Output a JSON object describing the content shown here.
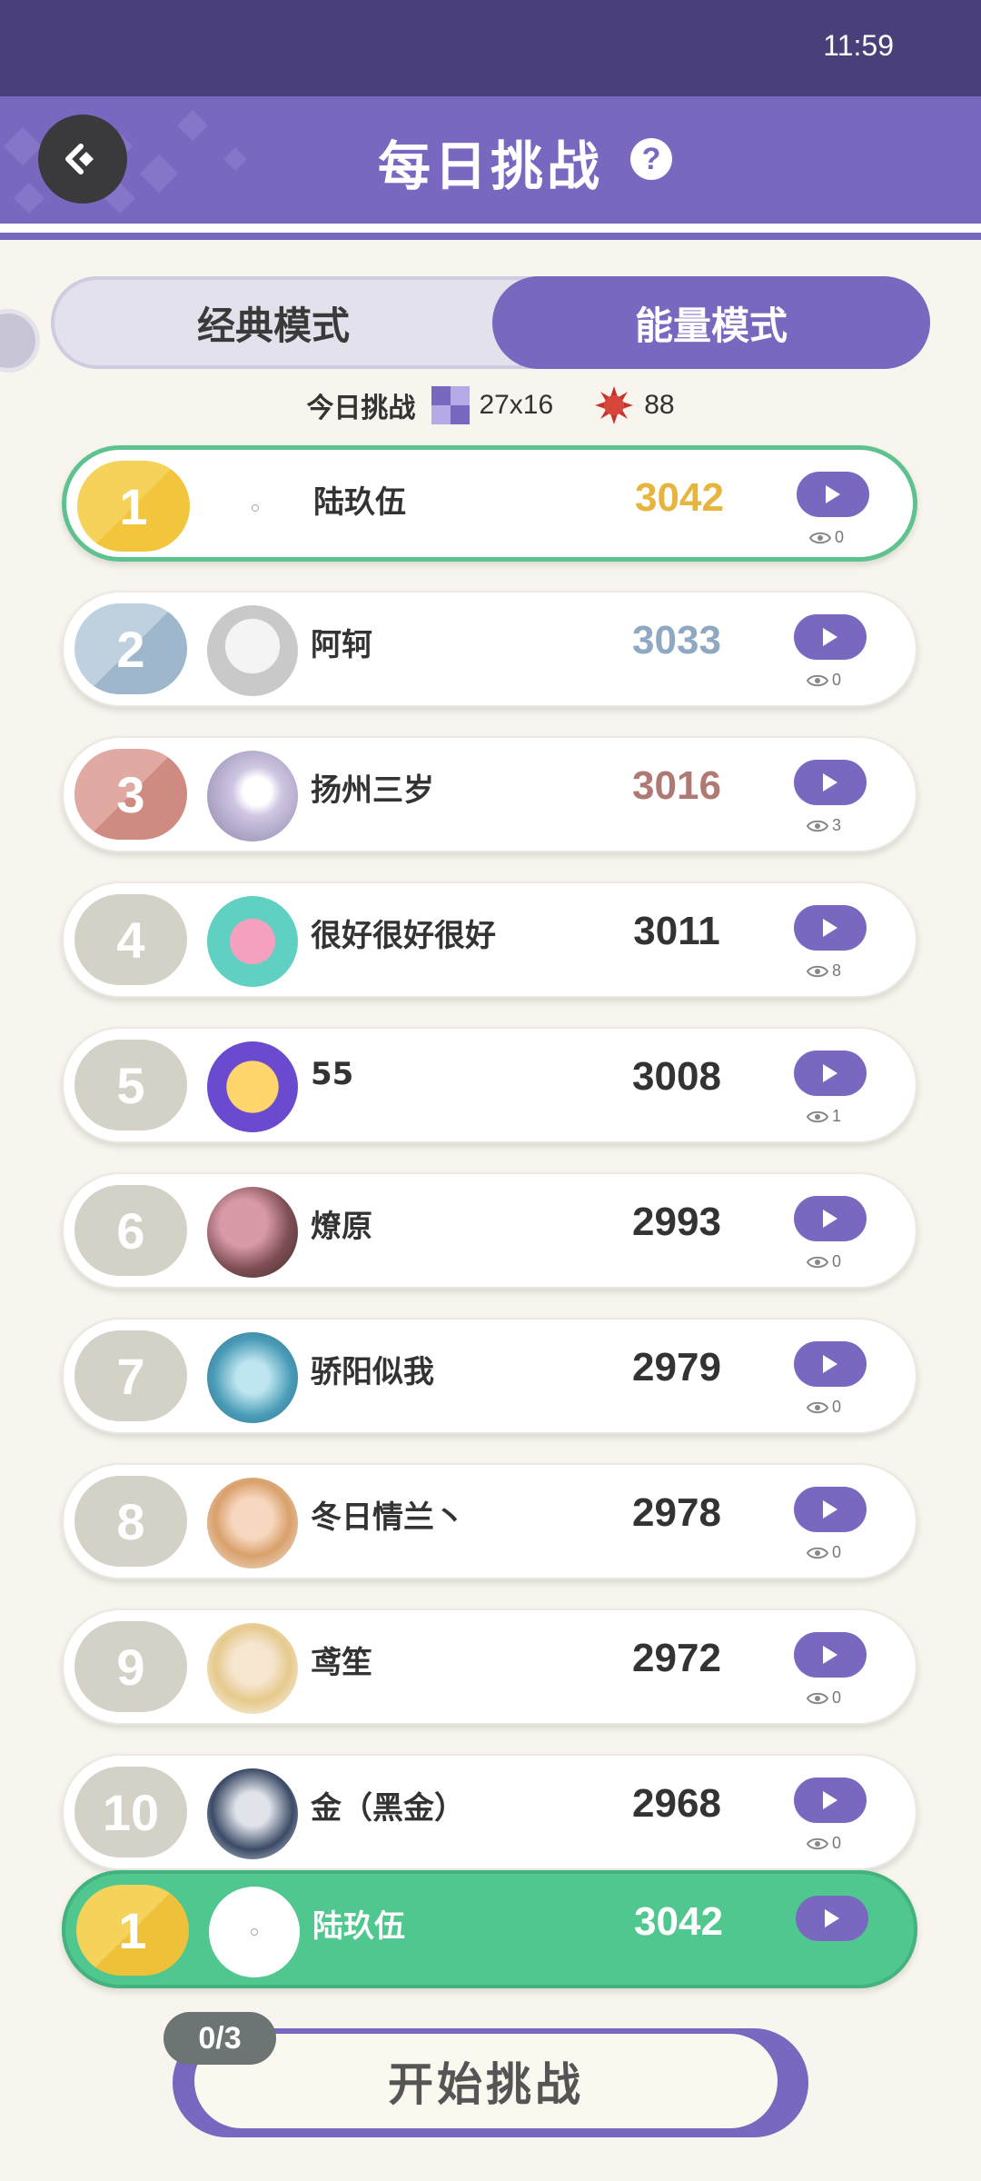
{
  "status_bar": {
    "time": "11:59"
  },
  "header": {
    "title": "每日挑战",
    "help_glyph": "?",
    "back_icon": "back-arrow-icon"
  },
  "mode_toggle": {
    "tabs": [
      {
        "label": "经典模式",
        "active": false
      },
      {
        "label": "能量模式",
        "active": true
      }
    ]
  },
  "today": {
    "label": "今日挑战",
    "grid_size": "27x16",
    "energy": "88"
  },
  "colors": {
    "accent": "#7a67c0",
    "gold": "#f2c53d",
    "silver": "#9fb7cd",
    "bronze": "#cf8a82",
    "grey_rank": "#d4d1c7",
    "mine_row": "#4fc78e"
  },
  "leaderboard": [
    {
      "rank": "1",
      "name": "陆玖伍",
      "score": "3042",
      "views": "0"
    },
    {
      "rank": "2",
      "name": "阿轲",
      "score": "3033",
      "views": "0"
    },
    {
      "rank": "3",
      "name": "扬州三岁",
      "score": "3016",
      "views": "3"
    },
    {
      "rank": "4",
      "name": "很好很好很好",
      "score": "3011",
      "views": "8"
    },
    {
      "rank": "5",
      "name": "55",
      "score": "3008",
      "views": "1"
    },
    {
      "rank": "6",
      "name": "燎原",
      "score": "2993",
      "views": "0"
    },
    {
      "rank": "7",
      "name": "骄阳似我",
      "score": "2979",
      "views": "0"
    },
    {
      "rank": "8",
      "name": "冬日情兰丶",
      "score": "2978",
      "views": "0"
    },
    {
      "rank": "9",
      "name": "鸢笙",
      "score": "2972",
      "views": "0"
    },
    {
      "rank": "10",
      "name": "金（黑金）",
      "score": "2968",
      "views": "0"
    }
  ],
  "my_rank": {
    "rank": "1",
    "name": "陆玖伍",
    "score": "3042"
  },
  "start": {
    "label": "开始挑战",
    "attempts": "0/3"
  }
}
